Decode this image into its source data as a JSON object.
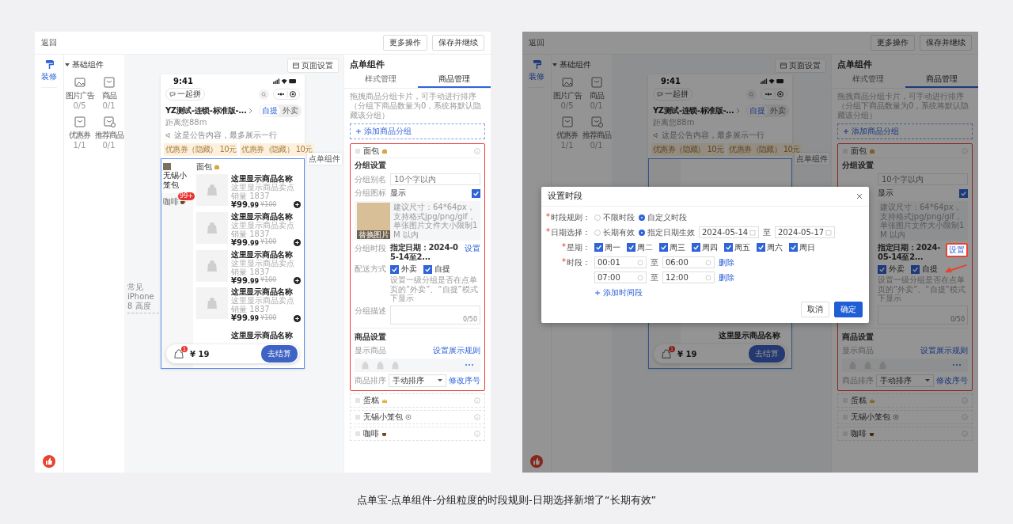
{
  "left_screen": {
    "header": {
      "back": "返回",
      "buttons": [
        "更多操作",
        "保存并继续"
      ]
    },
    "sidebar": {
      "items": [
        {
          "label": "装修",
          "selected": true
        }
      ]
    },
    "components": {
      "title": "基础组件",
      "expanded": true,
      "items": [
        {
          "name": "图片广告",
          "count": "0/5",
          "kind": "image"
        },
        {
          "name": "商品",
          "count": "0/1",
          "kind": "bag"
        },
        {
          "name": "优惠券",
          "count": "1/1",
          "kind": "bag"
        },
        {
          "name": "推荐商品",
          "count": "0/1",
          "kind": "bag-heart"
        }
      ]
    },
    "canvas": {
      "page_settings": "页面设置",
      "height_marker": "常见 iPhone 8 高度",
      "component_tag": "点单组件"
    },
    "phone": {
      "time": "9:41",
      "group_buy": "一起拼",
      "store": "YZ测试-连锁-标准版-...",
      "distance": "距离您88m",
      "modes": [
        {
          "label": "自提",
          "selected": true
        },
        {
          "label": "外卖",
          "selected": false
        }
      ],
      "notice": "这是公告内容，最多展示一行",
      "coupons": [
        {
          "label": "优惠券（隐藏）",
          "value": "10元"
        },
        {
          "label": "优惠券（隐藏）",
          "value": "10元"
        }
      ],
      "categories": [
        {
          "label": "无锡小笼包",
          "kind": "photo",
          "selected": true
        },
        {
          "label": "咖啡",
          "kind": "coffee",
          "badge": "99+",
          "selected": false
        }
      ],
      "group_title": "面包",
      "products": [
        {
          "name": "这里显示商品名称",
          "selling_point": "这里显示商品卖点",
          "sales": "销量 1837",
          "price": "¥99",
          "decimal": ".99",
          "original_price": "¥100"
        },
        {
          "name": "这里显示商品名称",
          "selling_point": "这里显示商品卖点",
          "sales": "销量 1837",
          "price": "¥99",
          "decimal": ".99",
          "original_price": "¥100"
        },
        {
          "name": "这里显示商品名称",
          "selling_point": "这里显示商品卖点",
          "sales": "销量 1837",
          "price": "¥99",
          "decimal": ".99",
          "original_price": "¥100"
        },
        {
          "name": "这里显示商品名称",
          "selling_point": "这里显示商品卖点",
          "sales": "销量 1837",
          "price": "¥99",
          "decimal": ".99",
          "original_price": "¥100"
        }
      ],
      "peek_product": "这里显示商品名称",
      "cart": {
        "count": "1",
        "total": "¥ 19",
        "checkout": "去结算"
      }
    },
    "panel": {
      "title": "点单组件",
      "tabs": [
        {
          "label": "样式管理",
          "selected": false
        },
        {
          "label": "商品管理",
          "selected": true
        }
      ],
      "description": "拖拽商品分组卡片，可手动进行排序（分组下商品数量为0，系统将默认隐藏该分组）",
      "add_group": "添加商品分组",
      "groups": [
        {
          "name": "面包",
          "kind": "bread",
          "expanded": true
        },
        {
          "name": "蛋糕",
          "kind": "cake",
          "expanded": false
        },
        {
          "name": "无锡小笼包",
          "kind": "ring",
          "expanded": false
        },
        {
          "name": "咖啡",
          "kind": "coffee",
          "expanded": false
        }
      ],
      "detail": {
        "section": "分组设置",
        "alias": {
          "label": "分组别名",
          "placeholder": "10个字以内"
        },
        "icon": {
          "label": "分组图标",
          "value": "显示",
          "checked": true,
          "hint": "建议尺寸：64*64px，支持格式jpg/png/gif，单张图片文件大小限制1M 以内",
          "replace": "替换图片"
        },
        "period": {
          "label": "分组时段",
          "value": "指定日期：2024-05-14至2...",
          "action": "设置",
          "highlighted": false
        },
        "delivery": {
          "label": "配送方式",
          "options": [
            {
              "label": "外卖",
              "checked": true
            },
            {
              "label": "自提",
              "checked": true
            }
          ],
          "note": "设置一级分组是否在点单页的“外卖”、“自提”模式下显示"
        },
        "desc": {
          "label": "分组描述",
          "counter": "0/50"
        },
        "goods": {
          "title": "商品设置",
          "show_label": "显示商品",
          "rule_link": "设置展示规则",
          "sort_label": "商品排序",
          "sort_value": "手动排序",
          "sort_link": "修改序号"
        }
      }
    }
  },
  "right_screen": {
    "header": {
      "back": "返回",
      "buttons": [
        "更多操作",
        "保存并继续"
      ]
    },
    "sidebar": {
      "items": [
        {
          "label": "装修",
          "selected": true
        }
      ]
    },
    "components": {
      "title": "基础组件",
      "expanded": true,
      "items": [
        {
          "name": "图片广告",
          "count": "0/5",
          "kind": "image"
        },
        {
          "name": "商品",
          "count": "0/1",
          "kind": "bag"
        },
        {
          "name": "优惠券",
          "count": "1/1",
          "kind": "bag"
        },
        {
          "name": "推荐商品",
          "count": "0/1",
          "kind": "bag-heart"
        }
      ]
    },
    "canvas": {
      "page_settings": "页面设置",
      "component_tag": "点单组件"
    },
    "phone": {
      "time": "9:41",
      "group_buy": "一起拼",
      "store": "YZ测试-连锁-标准版-...",
      "distance": "距离您88m",
      "modes": [
        {
          "label": "自提",
          "selected": true
        },
        {
          "label": "外卖",
          "selected": false
        }
      ],
      "notice": "这是公告内容，最多展示一行",
      "coupons": [
        {
          "label": "优惠券（隐藏）",
          "value": "10元"
        },
        {
          "label": "优惠券（隐藏）",
          "value": "10元"
        }
      ],
      "peek_product": "这里显示商品名称",
      "cart": {
        "count": "1",
        "total": "¥ 19",
        "checkout": "去结算"
      }
    },
    "panel": {
      "title": "点单组件",
      "tabs": [
        {
          "label": "样式管理",
          "selected": false
        },
        {
          "label": "商品管理",
          "selected": true
        }
      ],
      "description": "拖拽商品分组卡片，可手动进行排序（分组下商品数量为0，系统将默认隐藏该分组）",
      "add_group": "添加商品分组",
      "groups": [
        {
          "name": "面包",
          "kind": "bread",
          "expanded": true
        },
        {
          "name": "蛋糕",
          "kind": "cake",
          "expanded": false
        },
        {
          "name": "无锡小笼包",
          "kind": "ring",
          "expanded": false
        },
        {
          "name": "咖啡",
          "kind": "coffee",
          "expanded": false
        }
      ],
      "detail": {
        "section": "分组设置",
        "alias": {
          "placeholder": "10个字以内"
        },
        "icon": {
          "value": "显示",
          "checked": true,
          "hint": "建议尺寸：64*64px，支持格式jpg/png/gif，单张图片文件大小限制1M 以内"
        },
        "period": {
          "value": "指定日期：2024-05-14至2...",
          "action": "设置",
          "highlighted": true
        },
        "delivery": {
          "options": [
            {
              "label": "外卖",
              "checked": true
            },
            {
              "label": "自提",
              "checked": true
            }
          ],
          "note": "设置一级分组是否在点单页的“外卖”、“自提”模式下显示"
        },
        "desc": {
          "counter": "0/50"
        },
        "goods": {
          "title": "商品设置",
          "show_label": "显示商品",
          "rule_link": "设置展示规则",
          "sort_label": "商品排序",
          "sort_value": "手动排序",
          "sort_link": "修改序号"
        }
      }
    },
    "dialog": {
      "title": "设置时段",
      "period_rule": {
        "mark": "*",
        "label": "时段规则：",
        "options": [
          {
            "label": "不限时段",
            "selected": false
          },
          {
            "label": "自定义时段",
            "selected": true
          }
        ]
      },
      "date": {
        "mark": "*",
        "label": "日期选择：",
        "options": [
          {
            "label": "长期有效",
            "selected": false
          },
          {
            "label": "指定日期生效",
            "selected": true
          }
        ],
        "start": "2024-05-14",
        "to": "至",
        "end": "2024-05-17"
      },
      "weekdays": {
        "mark": "*",
        "label": "星期：",
        "days": [
          {
            "label": "周一",
            "checked": true
          },
          {
            "label": "周二",
            "checked": true
          },
          {
            "label": "周三",
            "checked": true
          },
          {
            "label": "周四",
            "checked": true
          },
          {
            "label": "周五",
            "checked": true
          },
          {
            "label": "周六",
            "checked": true
          },
          {
            "label": "周日",
            "checked": true
          }
        ]
      },
      "slots": {
        "mark": "*",
        "label": "时段：",
        "items": [
          {
            "start": "00:01",
            "to": "至",
            "end": "06:00",
            "delete": "删除"
          },
          {
            "start": "07:00",
            "to": "至",
            "end": "12:00",
            "delete": "删除"
          }
        ],
        "add": "添加时间段"
      },
      "cancel": "取消",
      "ok": "确定"
    }
  },
  "caption": "点单宝-点单组件-分组粒度的时段规则-日期选择新增了“长期有效”"
}
